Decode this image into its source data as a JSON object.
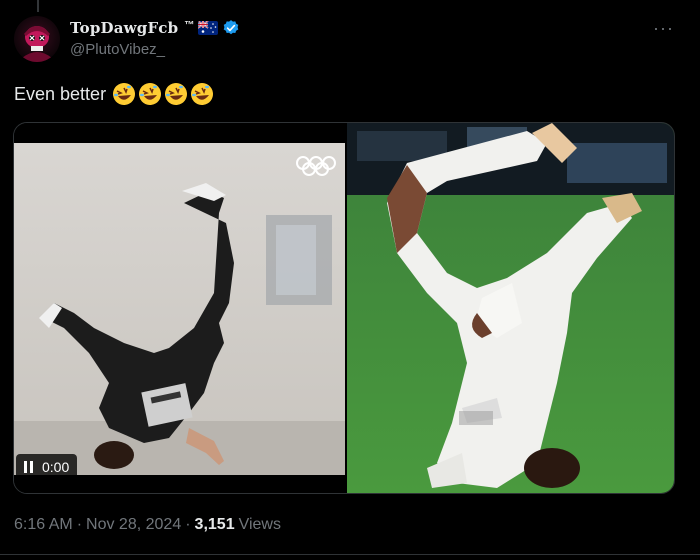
{
  "author": {
    "display_name": "TopDawgFcb",
    "tm": "™",
    "handle": "@PlutoVibez_",
    "flag_icon": "australia-flag-icon",
    "verified_icon": "verified-badge-icon"
  },
  "menu": {
    "more_label": "···"
  },
  "tweet": {
    "text": "Even better",
    "emoji_icons": [
      "rolling-on-floor-laughing-emoji",
      "rolling-on-floor-laughing-emoji",
      "rolling-on-floor-laughing-emoji",
      "rolling-on-floor-laughing-emoji"
    ]
  },
  "media": {
    "video": {
      "time": "0:00",
      "control_icon": "pause-icon"
    }
  },
  "meta": {
    "time": "6:16 AM",
    "separator": "·",
    "date": "Nov 28, 2024",
    "views_count": "3,151",
    "views_label": "Views"
  },
  "colors": {
    "background": "#000000",
    "text": "#e7e9ea",
    "muted": "#71767b",
    "verified": "#1d9bf0",
    "border": "#2f3336"
  }
}
